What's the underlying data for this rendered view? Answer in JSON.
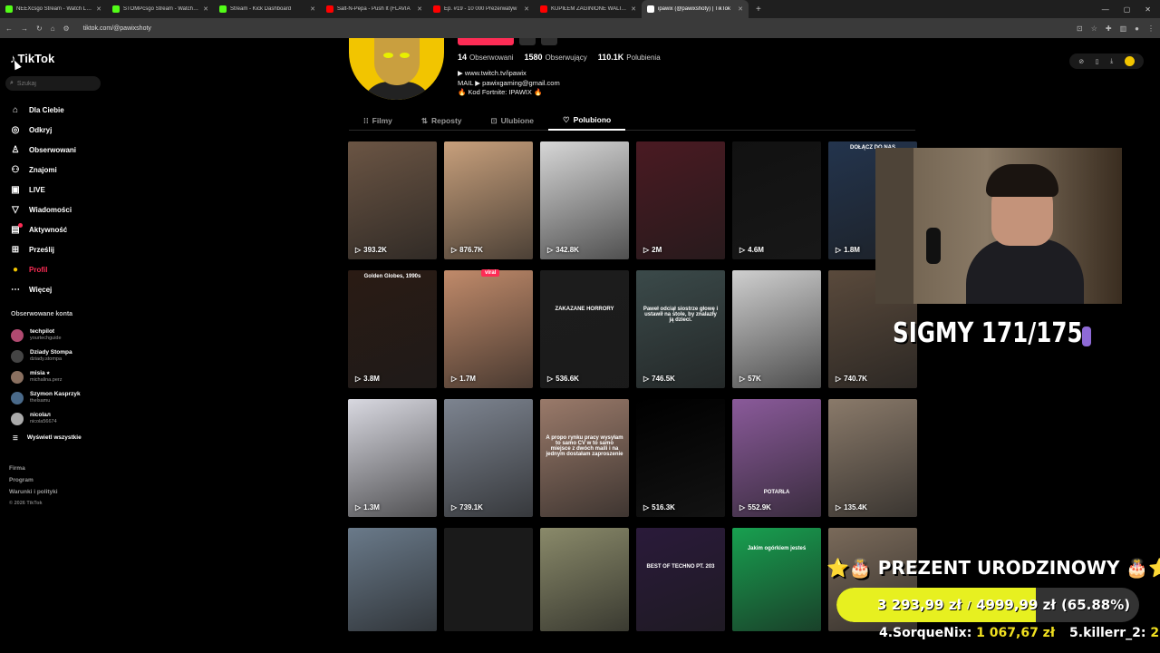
{
  "browser": {
    "tabs": [
      {
        "title": "NEEXcsgo Stream - Watch Live",
        "color": "#53fc18"
      },
      {
        "title": "STOMPcsgo Stream - Watch Live",
        "color": "#53fc18"
      },
      {
        "title": "Stream - Kick Dashboard",
        "color": "#53fc18"
      },
      {
        "title": "Salt-N-Pepa - Push It (FLAVIA",
        "color": "#ff0000"
      },
      {
        "title": "Ep. #19 - 10 000 Prezerwatyw",
        "color": "#ff0000"
      },
      {
        "title": "KUPIŁEM ZAGINIONE WALIZK",
        "color": "#ff0000"
      },
      {
        "title": "ipawix (@pawixshoty) | TikTok",
        "color": "#ffffff"
      }
    ],
    "new_tab": "+",
    "url": "tiktok.com/@pawixshoty"
  },
  "sidebar": {
    "logo": "TikTok",
    "search_placeholder": "Szukaj",
    "menu": [
      {
        "label": "Dla Ciebie",
        "icon": "home-icon",
        "glyph": "⌂"
      },
      {
        "label": "Odkryj",
        "icon": "compass-icon",
        "glyph": "◎"
      },
      {
        "label": "Obserwowani",
        "icon": "following-icon",
        "glyph": "♙"
      },
      {
        "label": "Znajomi",
        "icon": "friends-icon",
        "glyph": "⚇"
      },
      {
        "label": "LIVE",
        "icon": "live-icon",
        "glyph": "▣"
      },
      {
        "label": "Wiadomości",
        "icon": "messages-icon",
        "glyph": "▽"
      },
      {
        "label": "Aktywność",
        "icon": "activity-icon",
        "glyph": "▤"
      },
      {
        "label": "Prześlij",
        "icon": "upload-icon",
        "glyph": "⊞"
      },
      {
        "label": "Profil",
        "icon": "profile-icon",
        "glyph": "●"
      },
      {
        "label": "Więcej",
        "icon": "more-icon",
        "glyph": "⋯"
      }
    ],
    "followed_title": "Obserwowane konta",
    "followed": [
      {
        "name": "techpilot",
        "handle": "yourtechguide"
      },
      {
        "name": "Dziady Stompa",
        "handle": "dziady.stompa"
      },
      {
        "name": "misia ⭑",
        "handle": "michalina.perz"
      },
      {
        "name": "Szymon Kasprzyk",
        "handle": "thelsamu"
      },
      {
        "name": "nicolaл",
        "handle": "nicola56674"
      }
    ],
    "show_all": "Wyświetl wszystkie",
    "footer": [
      "Firma",
      "Program",
      "Warunki i polityki"
    ],
    "copyright": "© 2026 TikTok"
  },
  "profile": {
    "following_count": "14",
    "following_label": "Obserwowani",
    "followers_count": "1580",
    "followers_label": "Obserwujący",
    "likes_count": "110.1K",
    "likes_label": "Polubienia",
    "bio": [
      "▶ www.twitch.tv/ipawix",
      "MAIL ▶ pawixgaming@gmail.com",
      "🔥 Kod Fortnite: IPAWIX 🔥"
    ],
    "tabs": [
      {
        "label": "Filmy",
        "glyph": "⁞⁞"
      },
      {
        "label": "Reposty",
        "glyph": "⇅"
      },
      {
        "label": "Ulubione",
        "glyph": "⊡"
      },
      {
        "label": "Polubiono",
        "glyph": "♡"
      }
    ]
  },
  "videos": [
    {
      "views": "393.2K",
      "bg": "#6b5544",
      "caption": ""
    },
    {
      "views": "876.7K",
      "bg": "#c8a07c",
      "caption": ""
    },
    {
      "views": "342.8K",
      "bg": "#d7d7d7",
      "caption": ""
    },
    {
      "views": "2M",
      "bg": "#4a1a22",
      "caption": ""
    },
    {
      "views": "4.6M",
      "bg": "#111111",
      "caption": ""
    },
    {
      "views": "1.8M",
      "bg": "#23344d",
      "caption": "DOŁĄCZ DO NAS"
    },
    {
      "views": "3.8M",
      "bg": "#2a1b14",
      "caption": "Golden Globes, 1990s"
    },
    {
      "views": "1.7M",
      "bg": "#c08a6a",
      "caption": ""
    },
    {
      "views": "536.6K",
      "bg": "#1c1c1c",
      "caption": "ZAKAZANE HORRORY"
    },
    {
      "views": "746.5K",
      "bg": "#3b4a4a",
      "caption": "Paweł odciął siostrze głowę i ustawił na stole, by znalazły ją dzieci."
    },
    {
      "views": "57K",
      "bg": "#cfcfcf",
      "caption": ""
    },
    {
      "views": "740.7K",
      "bg": "#5a4a3c",
      "caption": ""
    },
    {
      "views": "1.3M",
      "bg": "#d8d8e0",
      "caption": ""
    },
    {
      "views": "739.1K",
      "bg": "#7d8490",
      "caption": ""
    },
    {
      "views": "",
      "bg": "#9a7a6a",
      "caption": "A propo rynku pracy wysyłam to samo CV w to samo miejsce z dwóch maili i na jednym dostałam zaproszenie"
    },
    {
      "views": "516.3K",
      "bg": "#000000",
      "caption": ""
    },
    {
      "views": "552.9K",
      "bg": "#8a5a9a",
      "caption": "POTARŁA"
    },
    {
      "views": "135.4K",
      "bg": "#8a7a6a",
      "caption": ""
    },
    {
      "views": "",
      "bg": "#6a7a8a",
      "caption": ""
    },
    {
      "views": "",
      "bg": "#1a1a1a",
      "caption": ""
    },
    {
      "views": "",
      "bg": "#8a8a6a",
      "caption": ""
    },
    {
      "views": "",
      "bg": "#2a1a3a",
      "caption": "BEST OF TECHNO PT. 203"
    },
    {
      "views": "",
      "bg": "#18a050",
      "caption": "Jakim ogórkiem jesteś"
    },
    {
      "views": "",
      "bg": "#7a6a5a",
      "caption": ""
    }
  ],
  "viral_badge": "viral",
  "overlay": {
    "sigmy": "SIGMY 171/175",
    "gift_title": "⭐🎂 PREZENT URODZINOWY 🎂⭐",
    "goal_current": "3 293,99 zł",
    "goal_target": "4999,99 zł",
    "goal_percent": "(65.88%)",
    "goal_fraction": 0.6588,
    "donors": [
      {
        "rank": "4.SorqueNix:",
        "amount": "1 067,67 zł"
      },
      {
        "rank": "5.killerr_2:",
        "amount": "2"
      }
    ]
  }
}
